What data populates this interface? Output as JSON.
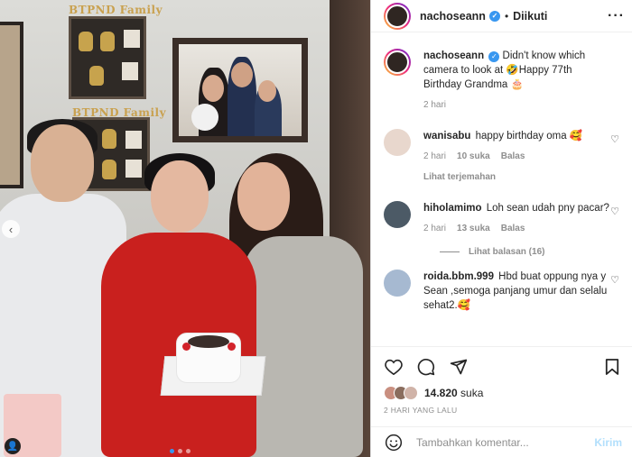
{
  "post": {
    "username": "nachoseann",
    "follow_status": "Diikuti",
    "caption_user": "nachoseann",
    "caption": "Didn't know which camera to look at 🤣Happy 77th Birthday Grandma 🎂",
    "caption_time": "2 hari"
  },
  "photo": {
    "wall_label_1": "BTPND Family",
    "wall_label_2": "BTPND Family"
  },
  "comments": [
    {
      "user": "wanisabu",
      "text": "happy birthday oma 🥰",
      "time": "2 hari",
      "likes": "10 suka",
      "reply": "Balas",
      "translate": "Lihat terjemahan"
    },
    {
      "user": "hiholamimo",
      "text": "Loh sean udah pny pacar?",
      "time": "2 hari",
      "likes": "13 suka",
      "reply": "Balas",
      "view_replies": "Lihat balasan (16)"
    },
    {
      "user": "roida.bbm.999",
      "text": "Hbd buat oppung nya y Sean ,semoga panjang umur dan selalu sehat2.🥰"
    }
  ],
  "engagement": {
    "likes_count": "14.820",
    "likes_label": "suka",
    "date": "2 HARI YANG LALU"
  },
  "composer": {
    "placeholder": "Tambahkan komentar...",
    "send_label": "Kirim"
  },
  "colors": {
    "accent_blue": "#3897f0",
    "send_disabled": "#b2dffc",
    "muted": "#8e8e8e"
  }
}
